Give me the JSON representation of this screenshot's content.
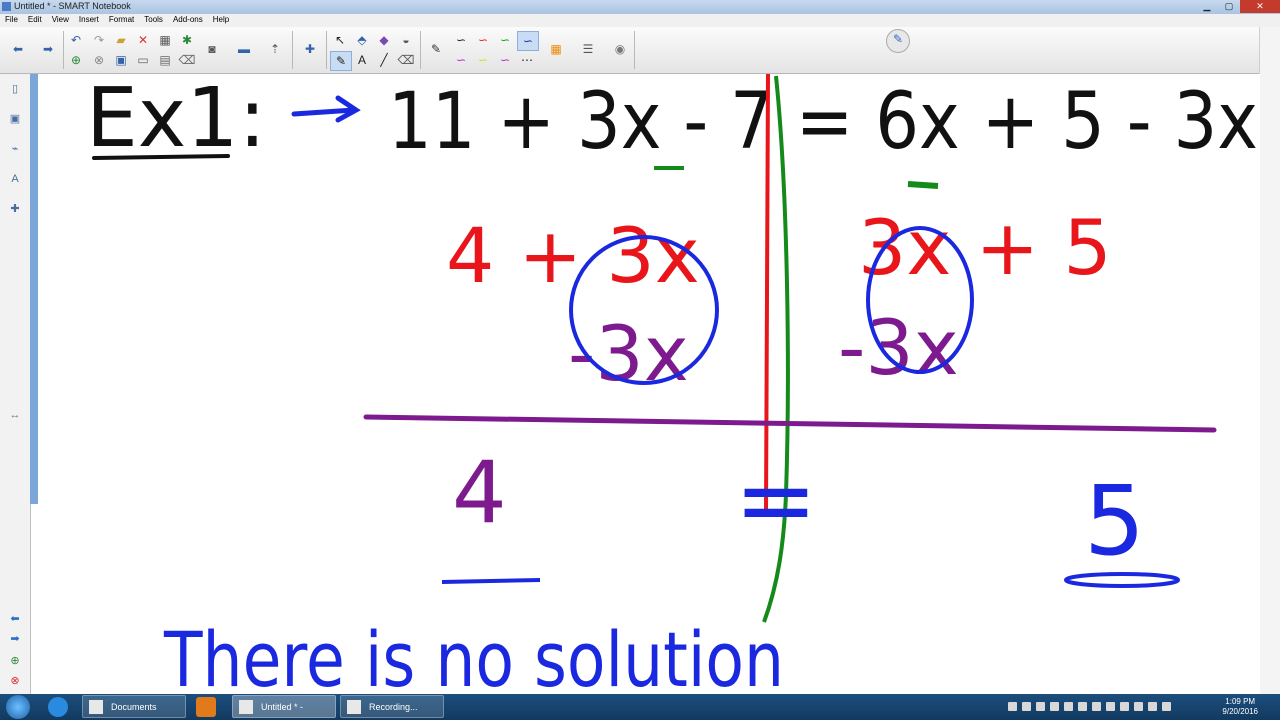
{
  "window": {
    "title": "Untitled * - SMART Notebook"
  },
  "menu": [
    "File",
    "Edit",
    "View",
    "Insert",
    "Format",
    "Tools",
    "Add-ons",
    "Help"
  ],
  "board": {
    "line1_prefix": "Ex1:",
    "line1_equation": "11 + 3x - 7 = 6x + 5 - 3x",
    "left_step1": "4 + 3x",
    "left_step2": "-3x",
    "left_result": "4",
    "right_step1": "3x + 5",
    "right_step2": "-3x",
    "right_result": "5",
    "equals_sign": "=",
    "conclusion": "There is no solution"
  },
  "taskbar": {
    "tasks": [
      "Documents",
      "Untitled * - SMAR...",
      "Recording..."
    ],
    "time": "1:09 PM",
    "date": "9/20/2016"
  },
  "colors": {
    "ink_black": "#111111",
    "ink_red": "#e8161b",
    "ink_blue": "#1a28e0",
    "ink_purple": "#7d1a8e",
    "ink_green": "#138a1a"
  }
}
